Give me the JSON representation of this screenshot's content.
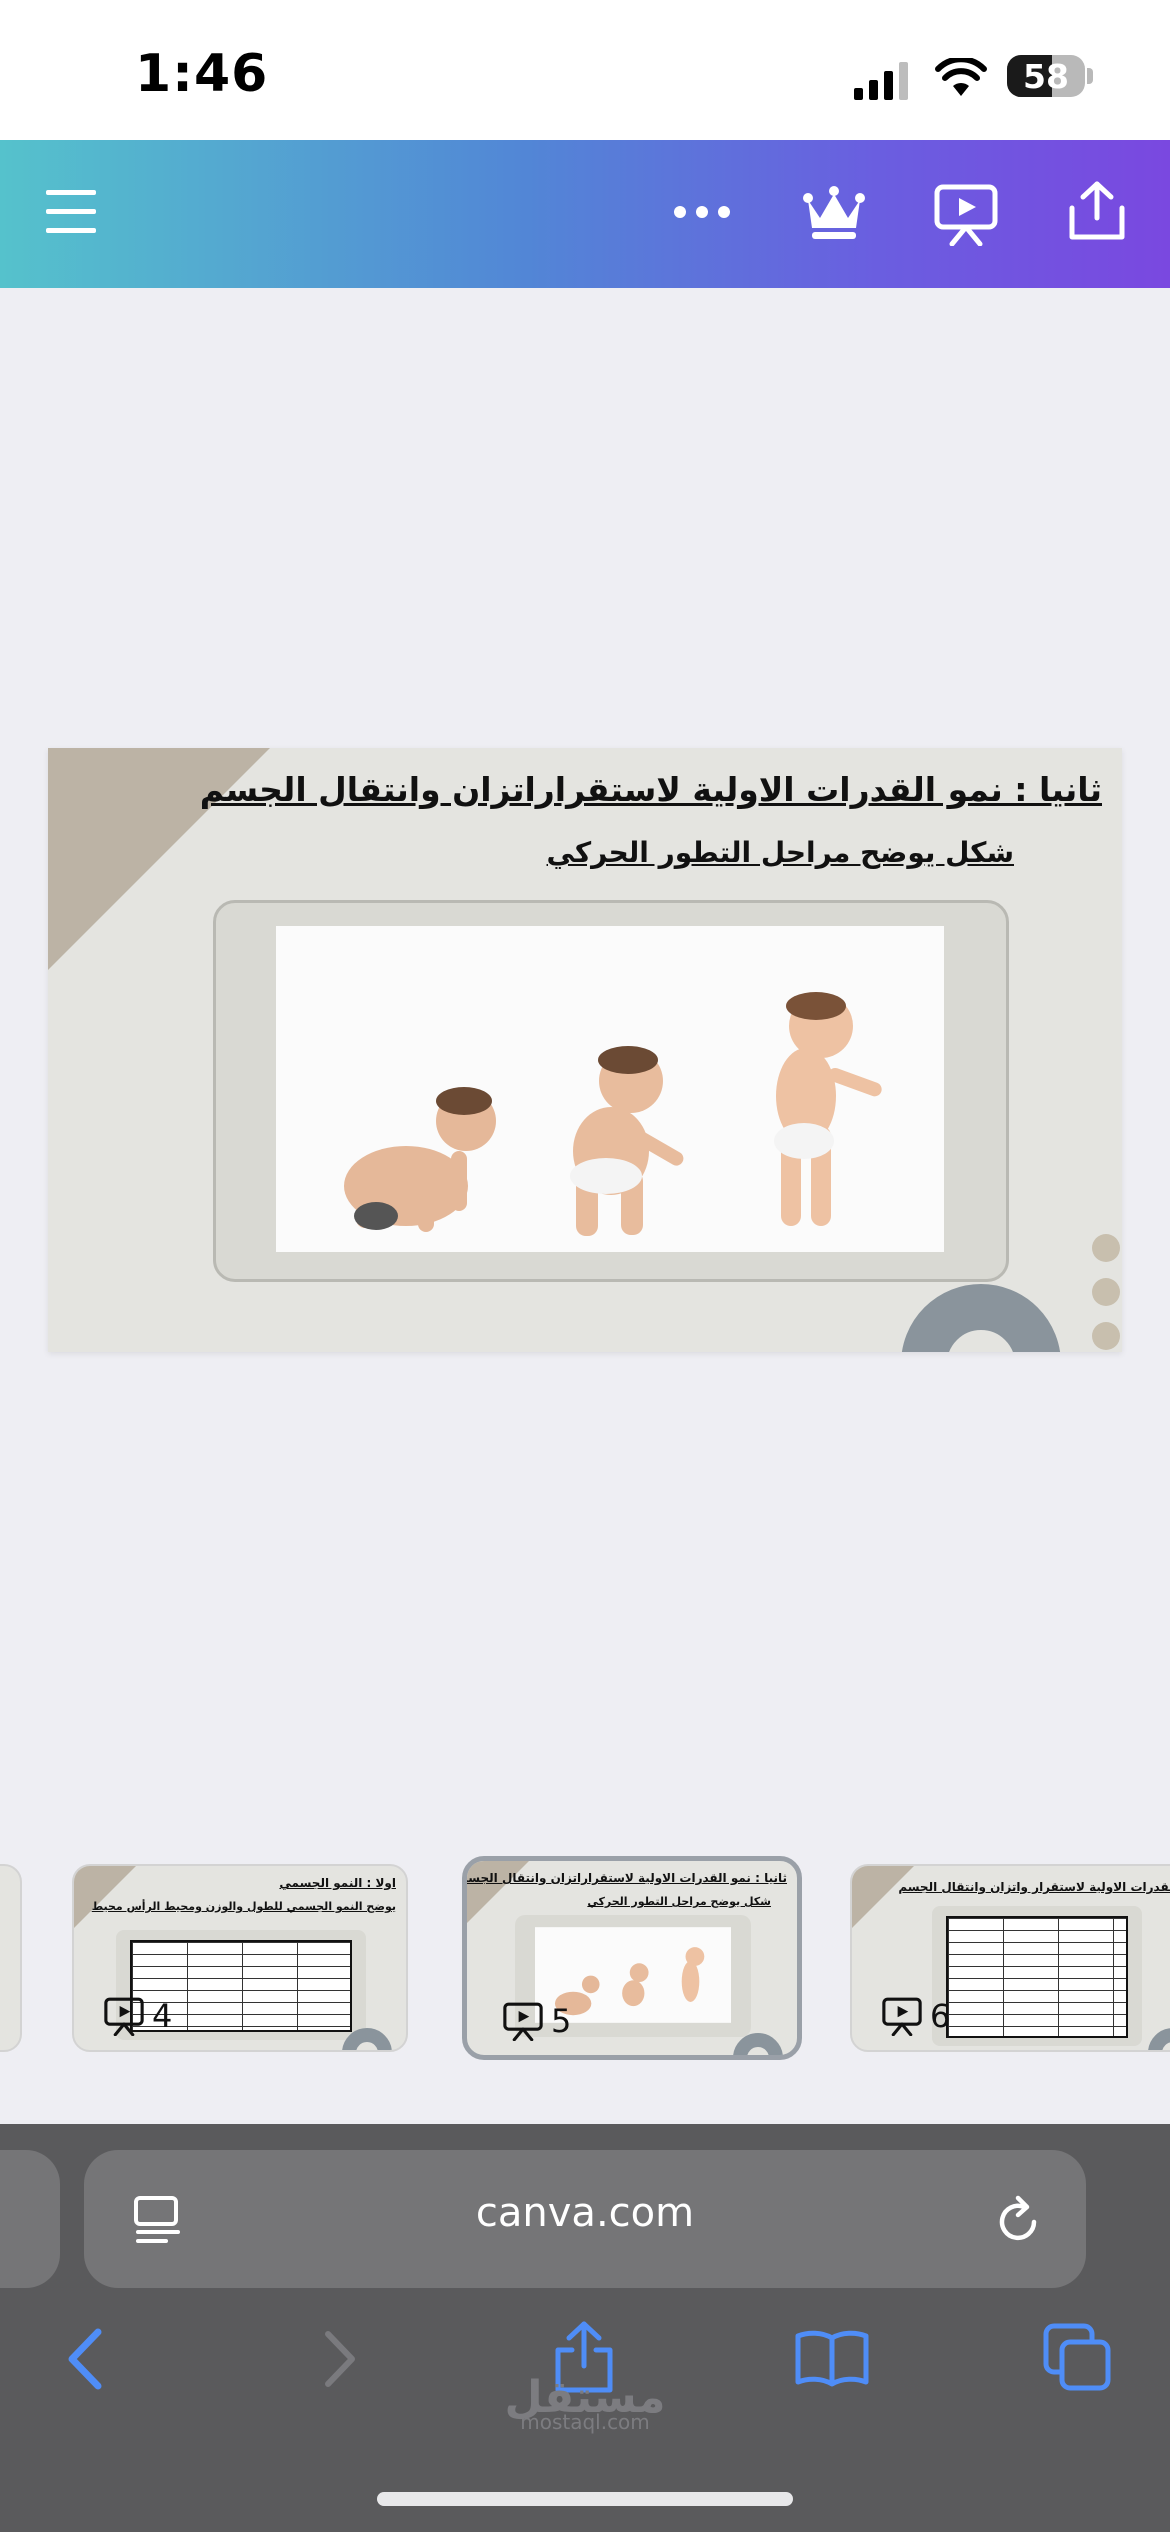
{
  "status_bar": {
    "time": "1:46",
    "battery_percent": 58,
    "battery_level": 0.58
  },
  "toolbar": {
    "icons": [
      "menu-icon",
      "more-icon",
      "crown-icon",
      "present-icon",
      "share-icon"
    ]
  },
  "slide": {
    "title": "ثانيا : نمو القدرات الاولية لاستقراراتزان وانتقال الجسم",
    "subtitle": "شكل  يوضح مراحل التطور الحركي"
  },
  "thumbnails": [
    {
      "number": "4",
      "title": "اولا : النمو الجسمي",
      "subtitle": "يوضح النمو الجسمي للطول والوزن ومحيط الرأس محيط",
      "selected": false
    },
    {
      "number": "5",
      "title": "ثانيا : نمو القدرات الاولية لاستقراراتزان وانتقال الجسم",
      "subtitle": "شكل  يوضح مراحل التطور الحركي",
      "selected": true
    },
    {
      "number": "6",
      "title": "نمو القدرات الاولية لاستقرار واتزان وانتقال الجسم",
      "subtitle": "",
      "selected": false
    }
  ],
  "browser": {
    "url": "canva.com",
    "icons": [
      "reader-icon",
      "reload-icon",
      "back-icon",
      "forward-icon",
      "share-icon",
      "bookmarks-icon",
      "tabs-icon"
    ]
  },
  "watermark": {
    "arabic": "مستقل",
    "latin": "mostaql.com"
  },
  "colors": {
    "toolbar_start": "#55c2cc",
    "toolbar_end": "#7a48e0",
    "safari_icon": "#4f8df7",
    "slide_accent": "#bcb3a5"
  }
}
